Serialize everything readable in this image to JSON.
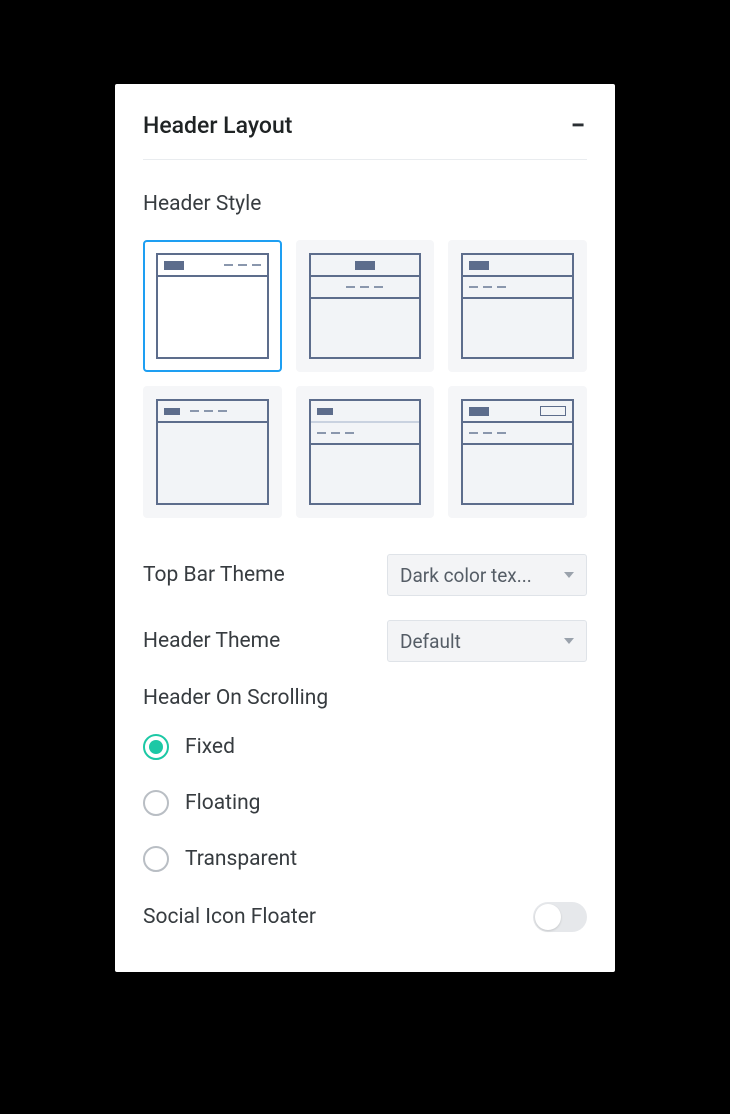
{
  "panel": {
    "title": "Header Layout"
  },
  "headerStyle": {
    "label": "Header Style",
    "selectedIndex": 0,
    "options": [
      {
        "id": "style-1"
      },
      {
        "id": "style-2"
      },
      {
        "id": "style-3"
      },
      {
        "id": "style-4"
      },
      {
        "id": "style-5"
      },
      {
        "id": "style-6"
      }
    ]
  },
  "topBarTheme": {
    "label": "Top Bar Theme",
    "value": "Dark color tex..."
  },
  "headerTheme": {
    "label": "Header Theme",
    "value": "Default"
  },
  "headerOnScrolling": {
    "label": "Header On Scrolling",
    "selected": "Fixed",
    "options": [
      "Fixed",
      "Floating",
      "Transparent"
    ]
  },
  "socialIconFloater": {
    "label": "Social Icon Floater",
    "enabled": false
  }
}
